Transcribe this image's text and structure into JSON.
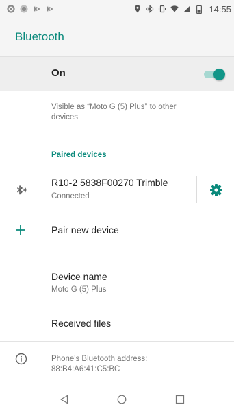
{
  "status_bar": {
    "time": "14:55",
    "left_icons": [
      "settings-status-icon",
      "record-status-icon",
      "play-store-icon",
      "play-store-icon-2"
    ],
    "right_icons": [
      "location-icon",
      "bluetooth-status-icon",
      "vibrate-icon",
      "wifi-icon",
      "signal-icon",
      "battery-icon"
    ]
  },
  "app_bar": {
    "title": "Bluetooth"
  },
  "master_switch": {
    "label": "On",
    "checked": true
  },
  "visibility": {
    "text": "Visible as “Moto G (5) Plus” to other devices"
  },
  "paired_section": {
    "header": "Paired devices",
    "devices": [
      {
        "name": "R10-2  5838F00270  Trimble",
        "status": "Connected",
        "icon": "bluetooth-connected-icon",
        "settings_icon": "gear-icon"
      }
    ]
  },
  "pair_new": {
    "label": "Pair new device",
    "icon": "plus-icon"
  },
  "device_name": {
    "title": "Device name",
    "value": "Moto G (5) Plus"
  },
  "received_files": {
    "label": "Received files"
  },
  "address": {
    "label": "Phone's Bluetooth address:",
    "value": "88:B4:A6:41:C5:BC",
    "icon": "info-icon"
  },
  "nav_bar": {
    "buttons": [
      "back-icon",
      "home-icon",
      "recents-icon"
    ]
  },
  "colors": {
    "accent": "#0b8a7c",
    "switch_on": "#119688",
    "status_bar_bg": "#f5f5f5",
    "master_row_bg": "#eeeeee",
    "secondary_text": "#757575"
  }
}
